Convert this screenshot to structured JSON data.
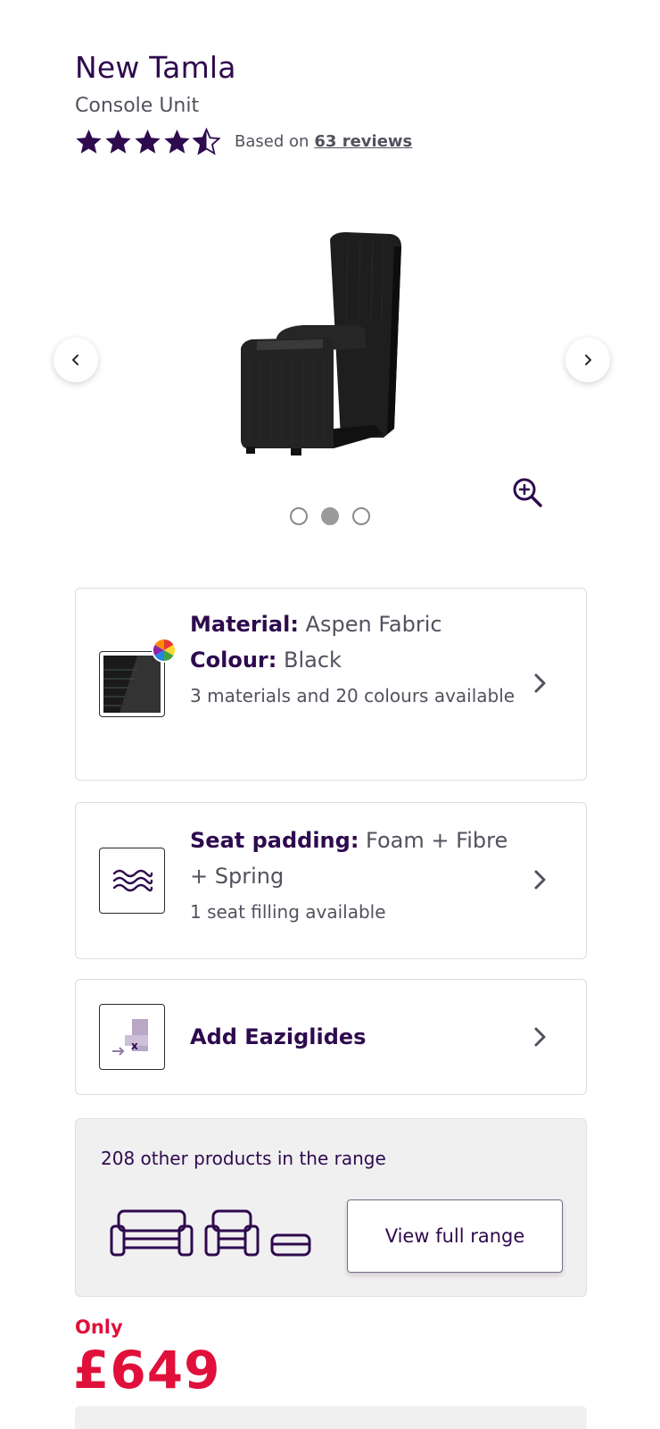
{
  "product": {
    "title": "New Tamla",
    "subtitle": "Console Unit",
    "rating_value": 4.5,
    "rating_prefix": "Based on ",
    "rating_link": "63 reviews"
  },
  "carousel": {
    "prev_icon": "chevron-left-icon",
    "next_icon": "chevron-right-icon",
    "zoom_icon": "zoom-in-icon",
    "slide_count": 3,
    "active_slide": 2
  },
  "options": {
    "material": {
      "label1": "Material:",
      "value1": " Aspen Fabric",
      "label2": "Colour:",
      "value2": " Black",
      "sub": "3 materials and 20 colours available"
    },
    "seat": {
      "label": "Seat padding:",
      "value": " Foam + Fibre + Spring",
      "sub": "1 seat filling available"
    },
    "glides": {
      "label": "Add Eaziglides"
    }
  },
  "range": {
    "text": "208 other products in the range",
    "button": "View full range"
  },
  "price": {
    "prefix": "Only",
    "amount": "£649"
  },
  "colors": {
    "brand": "#2e0a4e",
    "price": "#e0103a",
    "text": "#55505d"
  }
}
